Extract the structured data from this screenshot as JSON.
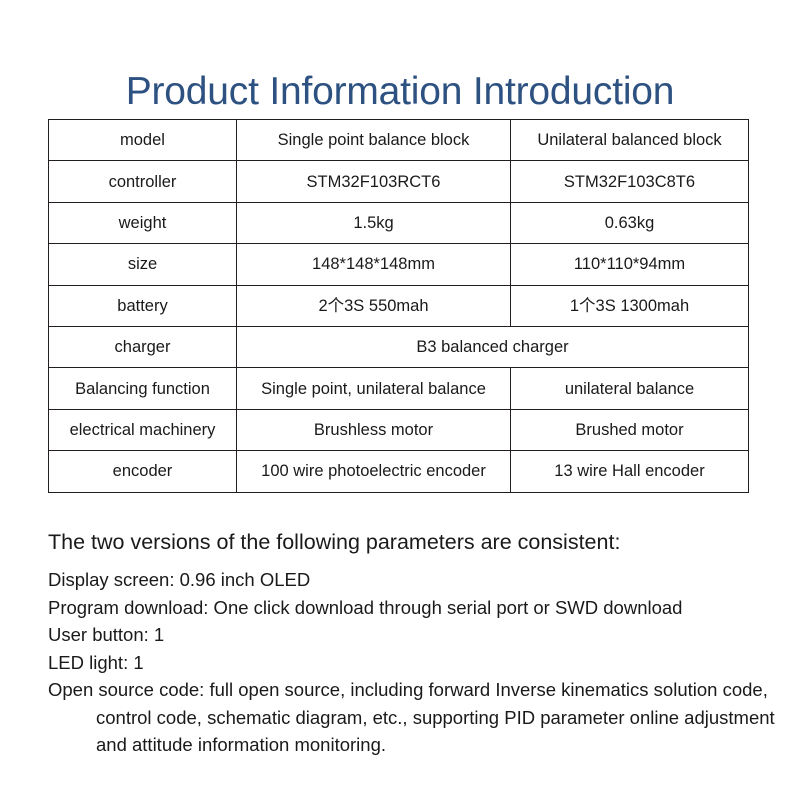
{
  "document": {
    "title": "Product Information Introduction",
    "title_color": "#2d5180",
    "background_color": "#ffffff",
    "text_color": "#1a1a1a",
    "table_border_color": "#231f20"
  },
  "spec_table": {
    "rows": [
      {
        "label": "model",
        "merged": false,
        "col_a": "Single point balance block",
        "col_b": "Unilateral balanced block"
      },
      {
        "label": "controller",
        "merged": false,
        "col_a": "STM32F103RCT6",
        "col_b": "STM32F103C8T6"
      },
      {
        "label": "weight",
        "merged": false,
        "col_a": "1.5kg",
        "col_b": "0.63kg"
      },
      {
        "label": "size",
        "merged": false,
        "col_a": "148*148*148mm",
        "col_b": "110*110*94mm"
      },
      {
        "label": "battery",
        "merged": false,
        "col_a": "2个3S 550mah",
        "col_b": "1个3S 1300mah"
      },
      {
        "label": "charger",
        "merged": true,
        "col_merged": "B3 balanced charger"
      },
      {
        "label": "Balancing function",
        "merged": false,
        "col_a": "Single point, unilateral balance",
        "col_b": "unilateral balance"
      },
      {
        "label": "electrical machinery",
        "merged": false,
        "col_a": "Brushless motor",
        "col_b": "Brushed motor"
      },
      {
        "label": "encoder",
        "merged": false,
        "col_a": "100 wire photoelectric encoder",
        "col_b": "13 wire Hall encoder"
      }
    ]
  },
  "notes": {
    "heading": "The two versions of the following parameters are consistent:",
    "lines": [
      "Display screen: 0.96 inch OLED",
      "Program download: One click download through serial port or SWD download",
      "User button: 1",
      "LED light: 1"
    ],
    "paragraph": "Open source code: full open source, including forward Inverse kinematics solution code, control code, schematic diagram, etc., supporting PID parameter online adjustment and attitude information monitoring."
  }
}
